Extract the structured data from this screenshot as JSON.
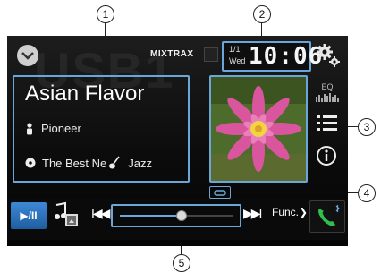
{
  "callouts": [
    "1",
    "2",
    "3",
    "4",
    "5"
  ],
  "source": {
    "watermark": "USB1",
    "menu_icon": "chevron-down-icon"
  },
  "header": {
    "mixtrax": "MIXTRAX",
    "date": "1/1",
    "day": "Wed",
    "time": "10:06"
  },
  "track": {
    "title": "Asian Flavor",
    "artist": "Pioneer",
    "album": "The Best Ne",
    "genre": "Jazz"
  },
  "side_controls": {
    "eq_label": "EQ"
  },
  "controls": {
    "play_pause": "▶/II",
    "prev": "I◀◀",
    "next": "▶▶I",
    "func": "Func.❯",
    "seek_fraction": 0.55
  },
  "colors": {
    "accent": "#6aa7d8",
    "play_button": "#2c73be",
    "screen_bg": "#101010"
  }
}
